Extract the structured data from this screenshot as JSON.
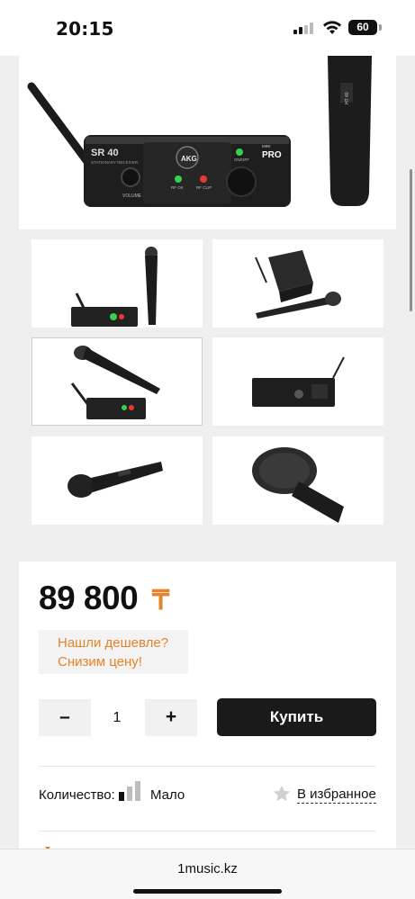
{
  "status_bar": {
    "time": "20:15",
    "battery": "60"
  },
  "gallery": {
    "main_image": {
      "receiver_model": "SR 40",
      "receiver_subtitle": "STATIONARY RECEIVER",
      "brand": "AKG",
      "mini_label": "MINI",
      "pro_label": "PRO",
      "volume_label": "VOLUME",
      "rf_ok_label": "RF OK",
      "rf_clip_label": "RF CLIP",
      "on_off_label": "ON/OFF",
      "mic_model": "HT 40"
    },
    "thumbnails": [
      {
        "label": "receiver-with-upright-mic",
        "selected": false
      },
      {
        "label": "receiver-and-mic-angled",
        "selected": false
      },
      {
        "label": "mic-over-receiver",
        "selected": true
      },
      {
        "label": "receiver-rear-panel",
        "selected": false
      },
      {
        "label": "mic-side-view",
        "selected": false
      },
      {
        "label": "mic-head-closeup",
        "selected": false
      }
    ]
  },
  "purchase": {
    "price": "89 800",
    "currency_symbol": "₸",
    "cheaper_line1": "Нашли дешевле?",
    "cheaper_line2": "Снизим цену!",
    "quantity_minus": "–",
    "quantity_value": "1",
    "quantity_plus": "+",
    "buy_label": "Купить",
    "stock_label": "Количество:",
    "stock_value": "Мало",
    "stock_level": "1 of 3",
    "favorites_label": "В избранное"
  },
  "browser": {
    "url": "1music.kz"
  },
  "colors": {
    "accent": "#e8822a",
    "buy_button": "#1a1a1a",
    "led_green": "#3bd04a",
    "led_red": "#e53a32"
  }
}
